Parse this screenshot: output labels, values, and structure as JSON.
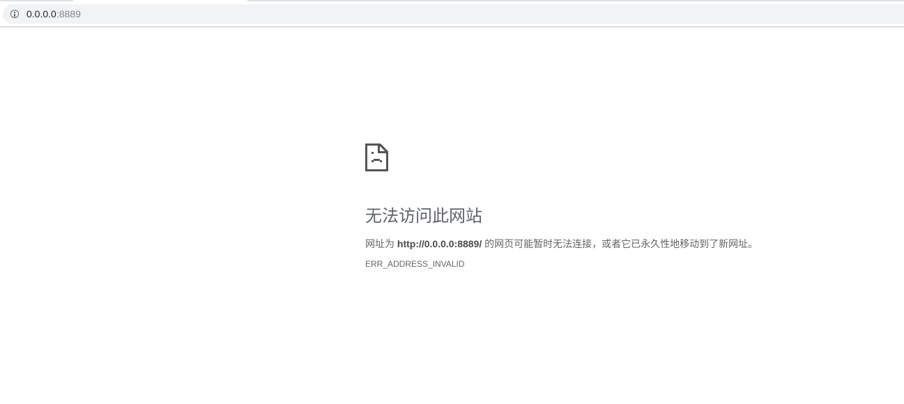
{
  "address_bar": {
    "host": "0.0.0.0",
    "port": ":8889",
    "icon": "info-icon"
  },
  "error": {
    "icon": "sad-page-icon",
    "title": "无法访问此网站",
    "desc_prefix": "网址为 ",
    "desc_url": "http://0.0.0.0:8889/",
    "desc_suffix": " 的网页可能暂时无法连接，或者它已永久性地移动到了新网址。",
    "code": "ERR_ADDRESS_INVALID"
  }
}
